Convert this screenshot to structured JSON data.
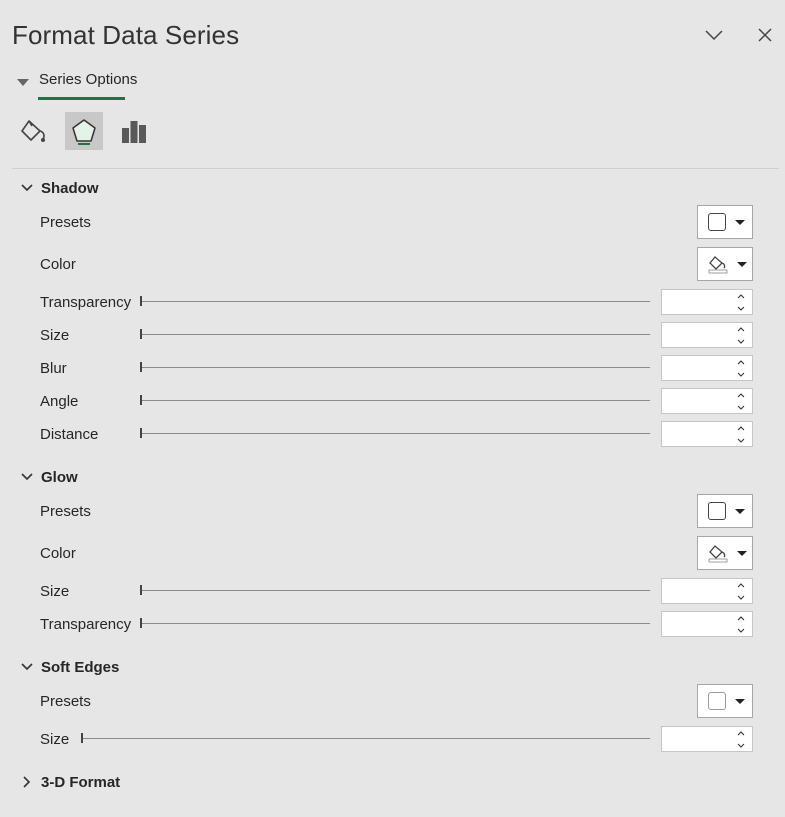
{
  "pane": {
    "title": "Format Data Series",
    "dropdown_icon": "chevron-down-icon",
    "close_icon": "close-icon"
  },
  "options_tab": {
    "label": "Series Options",
    "accent_color": "#217346"
  },
  "category_tabs": [
    {
      "icon": "paint-bucket-icon",
      "active": false
    },
    {
      "icon": "pentagon-effects-icon",
      "active": true
    },
    {
      "icon": "bar-chart-icon",
      "active": false
    }
  ],
  "sections": {
    "shadow": {
      "title": "Shadow",
      "presets_label": "Presets",
      "color_label": "Color",
      "transparency_label": "Transparency",
      "size_label": "Size",
      "blur_label": "Blur",
      "angle_label": "Angle",
      "distance_label": "Distance",
      "transparency_value": "",
      "size_value": "",
      "blur_value": "",
      "angle_value": "",
      "distance_value": ""
    },
    "glow": {
      "title": "Glow",
      "presets_label": "Presets",
      "color_label": "Color",
      "size_label": "Size",
      "transparency_label": "Transparency",
      "size_value": "",
      "transparency_value": ""
    },
    "soft_edges": {
      "title": "Soft Edges",
      "presets_label": "Presets",
      "size_label": "Size",
      "size_value": ""
    },
    "three_d_format": {
      "title": "3-D Format"
    }
  }
}
